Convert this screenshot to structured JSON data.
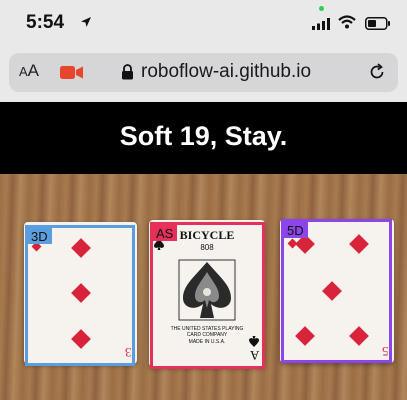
{
  "status_bar": {
    "time": "5:54",
    "icons": [
      "location-arrow-icon",
      "signal-icon",
      "wifi-icon",
      "battery-icon"
    ],
    "recording_dot_color": "#2fcf55"
  },
  "browser": {
    "text_size_label_big": "A",
    "text_size_label_small": "A",
    "url": "roboflow-ai.github.io",
    "icons": [
      "camera-icon",
      "lock-icon",
      "reload-icon"
    ],
    "camera_color": "#e8452f"
  },
  "banner": {
    "advice": "Soft 19, Stay."
  },
  "detections": [
    {
      "label": "3D",
      "color": "#5b9ee0"
    },
    {
      "label": "AS",
      "color": "#e5305a"
    },
    {
      "label": "5D",
      "color": "#8b45e8"
    }
  ],
  "cards": {
    "three_of_diamonds": {
      "rank": "3"
    },
    "ace_of_spades": {
      "brand": "BICYCLE",
      "sub": "808",
      "maker": "THE UNITED STATES PLAYING CARD COMPANY",
      "made": "MADE IN U.S.A.",
      "rank": "A"
    },
    "five_of_diamonds": {
      "rank": "5"
    }
  }
}
